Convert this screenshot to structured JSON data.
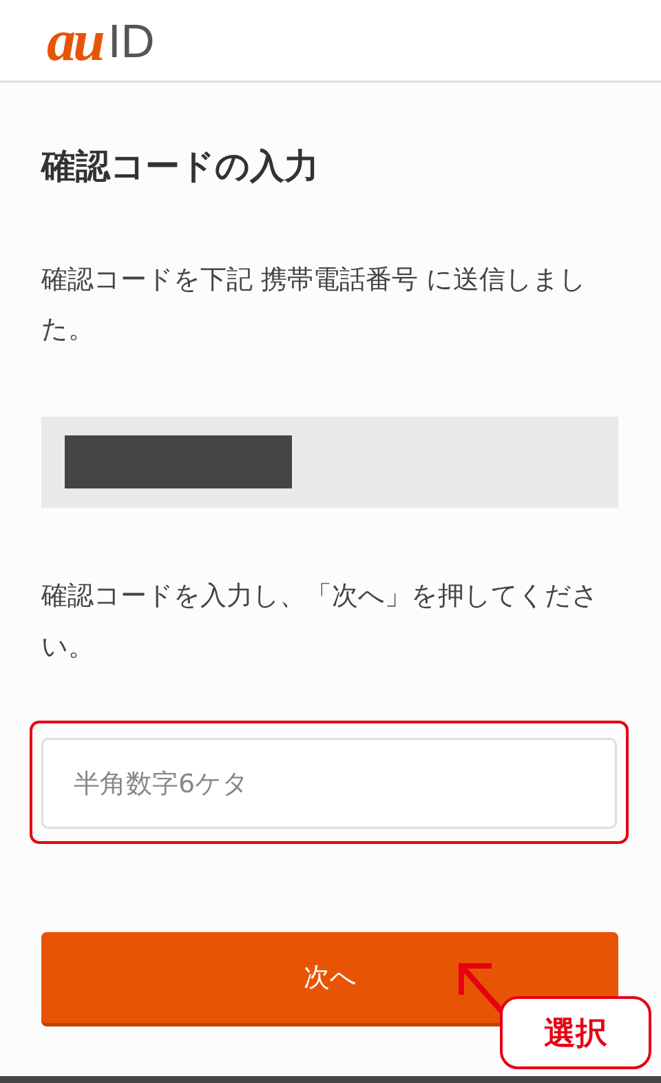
{
  "header": {
    "logo_brand": "au",
    "logo_suffix": "ID"
  },
  "title": "確認コードの入力",
  "message": "確認コードを下記 携帯電話番号 に送信しました。",
  "phone_box": {
    "redacted": true
  },
  "instruction": "確認コードを入力し、「次へ」を押してください。",
  "code_field": {
    "placeholder": "半角数字6ケタ",
    "highlighted": true
  },
  "next_button": {
    "label": "次へ"
  },
  "callout": {
    "label": "選択"
  }
}
